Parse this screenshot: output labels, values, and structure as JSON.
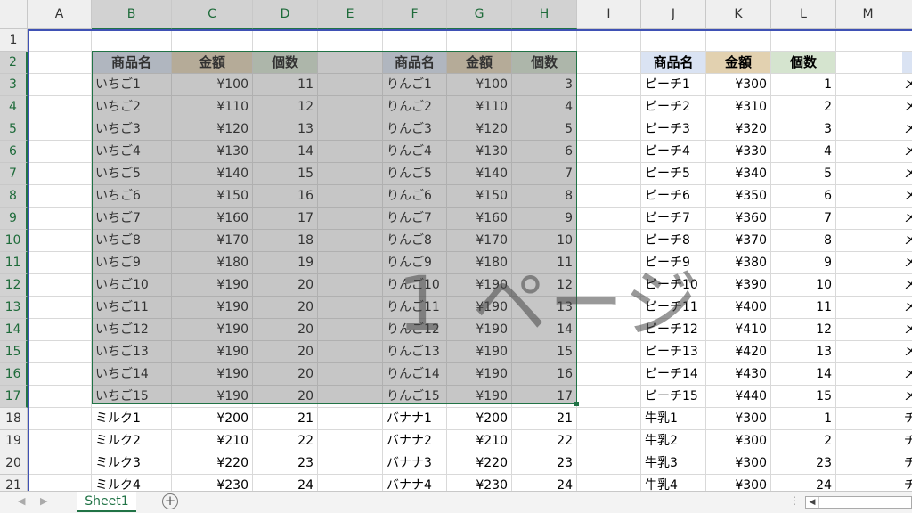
{
  "columns": [
    {
      "label": "A",
      "sel": false
    },
    {
      "label": "B",
      "sel": true
    },
    {
      "label": "C",
      "sel": true
    },
    {
      "label": "D",
      "sel": true
    },
    {
      "label": "E",
      "sel": true
    },
    {
      "label": "F",
      "sel": true
    },
    {
      "label": "G",
      "sel": true
    },
    {
      "label": "H",
      "sel": true
    },
    {
      "label": "I",
      "sel": false
    },
    {
      "label": "J",
      "sel": false
    },
    {
      "label": "K",
      "sel": false
    },
    {
      "label": "L",
      "sel": false
    },
    {
      "label": "M",
      "sel": false
    },
    {
      "label": "",
      "sel": false
    }
  ],
  "row_numbers": [
    "1",
    "2",
    "3",
    "4",
    "5",
    "6",
    "7",
    "8",
    "9",
    "10",
    "11",
    "12",
    "13",
    "14",
    "15",
    "16",
    "17",
    "18",
    "19",
    "20",
    "21"
  ],
  "header_colors": {
    "name": "#dae3f3",
    "price": "#e2d1b0",
    "qty": "#d5e4cf"
  },
  "tables": [
    {
      "headers": [
        "商品名",
        "金額",
        "個数"
      ],
      "rows": [
        [
          "いちご1",
          "¥100",
          "11"
        ],
        [
          "いちご2",
          "¥110",
          "12"
        ],
        [
          "いちご3",
          "¥120",
          "13"
        ],
        [
          "いちご4",
          "¥130",
          "14"
        ],
        [
          "いちご5",
          "¥140",
          "15"
        ],
        [
          "いちご6",
          "¥150",
          "16"
        ],
        [
          "いちご7",
          "¥160",
          "17"
        ],
        [
          "いちご8",
          "¥170",
          "18"
        ],
        [
          "いちご9",
          "¥180",
          "19"
        ],
        [
          "いちご10",
          "¥190",
          "20"
        ],
        [
          "いちご11",
          "¥190",
          "20"
        ],
        [
          "いちご12",
          "¥190",
          "20"
        ],
        [
          "いちご13",
          "¥190",
          "20"
        ],
        [
          "いちご14",
          "¥190",
          "20"
        ],
        [
          "いちご15",
          "¥190",
          "20"
        ],
        [
          "ミルク1",
          "¥200",
          "21"
        ],
        [
          "ミルク2",
          "¥210",
          "22"
        ],
        [
          "ミルク3",
          "¥220",
          "23"
        ],
        [
          "ミルク4",
          "¥230",
          "24"
        ]
      ]
    },
    {
      "headers": [
        "商品名",
        "金額",
        "個数"
      ],
      "rows": [
        [
          "りんご1",
          "¥100",
          "3"
        ],
        [
          "りんご2",
          "¥110",
          "4"
        ],
        [
          "りんご3",
          "¥120",
          "5"
        ],
        [
          "りんご4",
          "¥130",
          "6"
        ],
        [
          "りんご5",
          "¥140",
          "7"
        ],
        [
          "りんご6",
          "¥150",
          "8"
        ],
        [
          "りんご7",
          "¥160",
          "9"
        ],
        [
          "りんご8",
          "¥170",
          "10"
        ],
        [
          "りんご9",
          "¥180",
          "11"
        ],
        [
          "りんご10",
          "¥190",
          "12"
        ],
        [
          "りんご11",
          "¥190",
          "13"
        ],
        [
          "りんご12",
          "¥190",
          "14"
        ],
        [
          "りんご13",
          "¥190",
          "15"
        ],
        [
          "りんご14",
          "¥190",
          "16"
        ],
        [
          "りんご15",
          "¥190",
          "17"
        ],
        [
          "バナナ1",
          "¥200",
          "21"
        ],
        [
          "バナナ2",
          "¥210",
          "22"
        ],
        [
          "バナナ3",
          "¥220",
          "23"
        ],
        [
          "バナナ4",
          "¥230",
          "24"
        ]
      ]
    },
    {
      "headers": [
        "商品名",
        "金額",
        "個数"
      ],
      "rows": [
        [
          "ピーチ1",
          "¥300",
          "1"
        ],
        [
          "ピーチ2",
          "¥310",
          "2"
        ],
        [
          "ピーチ3",
          "¥320",
          "3"
        ],
        [
          "ピーチ4",
          "¥330",
          "4"
        ],
        [
          "ピーチ5",
          "¥340",
          "5"
        ],
        [
          "ピーチ6",
          "¥350",
          "6"
        ],
        [
          "ピーチ7",
          "¥360",
          "7"
        ],
        [
          "ピーチ8",
          "¥370",
          "8"
        ],
        [
          "ピーチ9",
          "¥380",
          "9"
        ],
        [
          "ピーチ10",
          "¥390",
          "10"
        ],
        [
          "ピーチ11",
          "¥400",
          "11"
        ],
        [
          "ピーチ12",
          "¥410",
          "12"
        ],
        [
          "ピーチ13",
          "¥420",
          "13"
        ],
        [
          "ピーチ14",
          "¥430",
          "14"
        ],
        [
          "ピーチ15",
          "¥440",
          "15"
        ],
        [
          "牛乳1",
          "¥300",
          "1"
        ],
        [
          "牛乳2",
          "¥300",
          "2"
        ],
        [
          "牛乳3",
          "¥300",
          "23"
        ],
        [
          "牛乳4",
          "¥300",
          "24"
        ]
      ]
    }
  ],
  "column_n_partial": [
    "メ",
    "メ",
    "メ",
    "メ",
    "メ",
    "メ",
    "メ",
    "メ",
    "メ",
    "メ",
    "メ",
    "メ",
    "メ",
    "メ",
    "メ",
    "チ",
    "チ",
    "チ",
    "チ"
  ],
  "page_label": "1 ページ",
  "sheet_tab": "Sheet1",
  "add_sheet_symbol": "+",
  "tab_options_symbol": "⋮",
  "nav_prev": "◀",
  "nav_next": "▶",
  "scroll_left_symbol": "◀"
}
